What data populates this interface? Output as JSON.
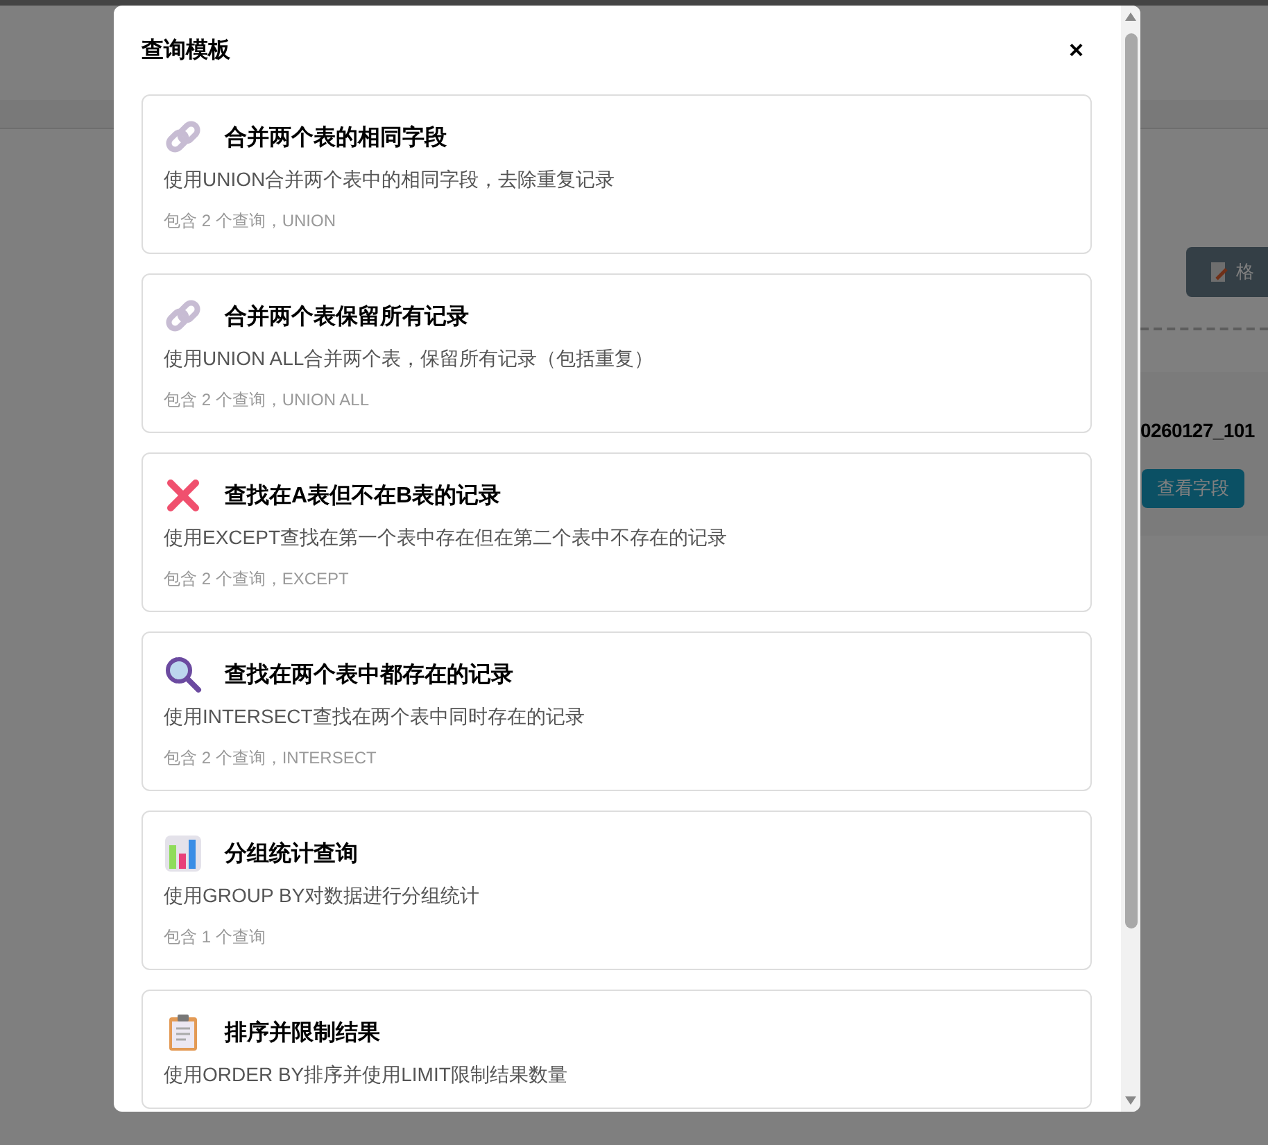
{
  "background": {
    "format_button": "格",
    "file_name": "0260127_101",
    "view_fields_button": "查看字段"
  },
  "modal": {
    "title": "查询模板",
    "close": "×",
    "templates": [
      {
        "title": "合并两个表的相同字段",
        "description": "使用UNION合并两个表中的相同字段，去除重复记录",
        "meta": "包含 2 个查询，UNION"
      },
      {
        "title": "合并两个表保留所有记录",
        "description": "使用UNION ALL合并两个表，保留所有记录（包括重复）",
        "meta": "包含 2 个查询，UNION ALL"
      },
      {
        "title": "查找在A表但不在B表的记录",
        "description": "使用EXCEPT查找在第一个表中存在但在第二个表中不存在的记录",
        "meta": "包含 2 个查询，EXCEPT"
      },
      {
        "title": "查找在两个表中都存在的记录",
        "description": "使用INTERSECT查找在两个表中同时存在的记录",
        "meta": "包含 2 个查询，INTERSECT"
      },
      {
        "title": "分组统计查询",
        "description": "使用GROUP BY对数据进行分组统计",
        "meta": "包含 1 个查询"
      },
      {
        "title": "排序并限制结果",
        "description": "使用ORDER BY排序并使用LIMIT限制结果数量"
      }
    ]
  }
}
